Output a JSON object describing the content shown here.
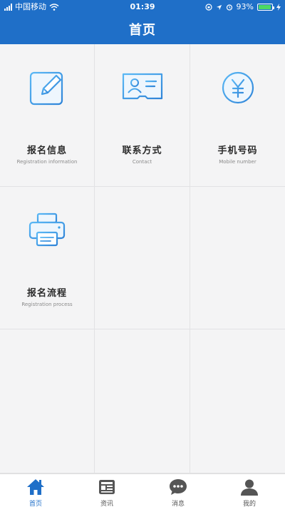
{
  "status_bar": {
    "carrier": "中国移动",
    "time": "01:39",
    "battery_percent": "93%",
    "battery_level": 0.93
  },
  "header": {
    "title": "首页"
  },
  "grid": {
    "items": [
      {
        "label": "报名信息",
        "sub": "Registration information",
        "icon": "edit-icon"
      },
      {
        "label": "联系方式",
        "sub": "Contact",
        "icon": "contact-card-icon"
      },
      {
        "label": "手机号码",
        "sub": "Mobile number",
        "icon": "yen-coin-icon"
      },
      {
        "label": "报名流程",
        "sub": "Registration process",
        "icon": "printer-icon"
      }
    ]
  },
  "tabbar": {
    "tabs": [
      {
        "label": "首页",
        "icon": "home-icon",
        "active": true
      },
      {
        "label": "资讯",
        "icon": "news-icon",
        "active": false
      },
      {
        "label": "消息",
        "icon": "message-icon",
        "active": false
      },
      {
        "label": "我的",
        "icon": "user-icon",
        "active": false
      }
    ]
  },
  "colors": {
    "primary": "#1f6fc8",
    "icon_blue": "#3aa0e8",
    "tab_inactive": "#555555",
    "background": "#f4f4f5"
  }
}
